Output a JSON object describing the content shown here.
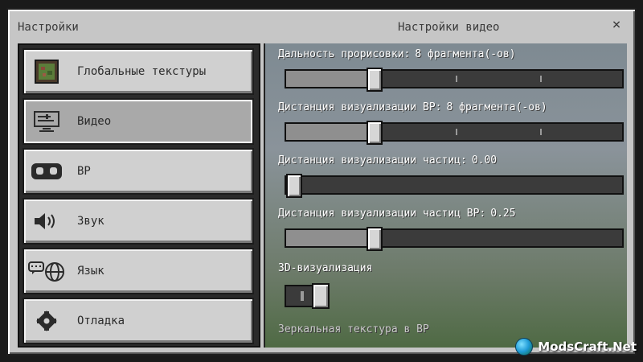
{
  "window": {
    "left_title": "Настройки",
    "right_title": "Настройки видео",
    "close_label": "×"
  },
  "sidebar": {
    "items": [
      {
        "label": "Глобальные текстуры",
        "icon": "texture-pack-icon",
        "selected": false
      },
      {
        "label": "Видео",
        "icon": "monitor-settings-icon",
        "selected": true
      },
      {
        "label": "ВР",
        "icon": "vr-goggles-icon",
        "selected": false
      },
      {
        "label": "Звук",
        "icon": "speaker-icon",
        "selected": false
      },
      {
        "label": "Язык",
        "icon": "language-globe-icon",
        "selected": false
      },
      {
        "label": "Отладка",
        "icon": "gear-icon",
        "selected": false
      }
    ]
  },
  "settings": {
    "render_distance": {
      "label": "Дальность прорисовки:",
      "value": "8 фрагмента(-ов)",
      "fraction": 0.25
    },
    "vr_render_distance": {
      "label": "Дистанция визуализации ВР:",
      "value": "8 фрагмента(-ов)",
      "fraction": 0.25
    },
    "particle_distance": {
      "label": "Дистанция визуализации частиц:",
      "value": "0.00",
      "fraction": 0.0
    },
    "vr_particle_distance": {
      "label": "Дистанция визуализации частиц ВР:",
      "value": "0.25",
      "fraction": 0.25
    },
    "render_3d": {
      "label": "3D-визуализация",
      "on": true
    },
    "mirror_texture": {
      "label": "Зеркальная текстура в ВР"
    }
  },
  "watermark": {
    "text": "ModsCraft.Net"
  }
}
